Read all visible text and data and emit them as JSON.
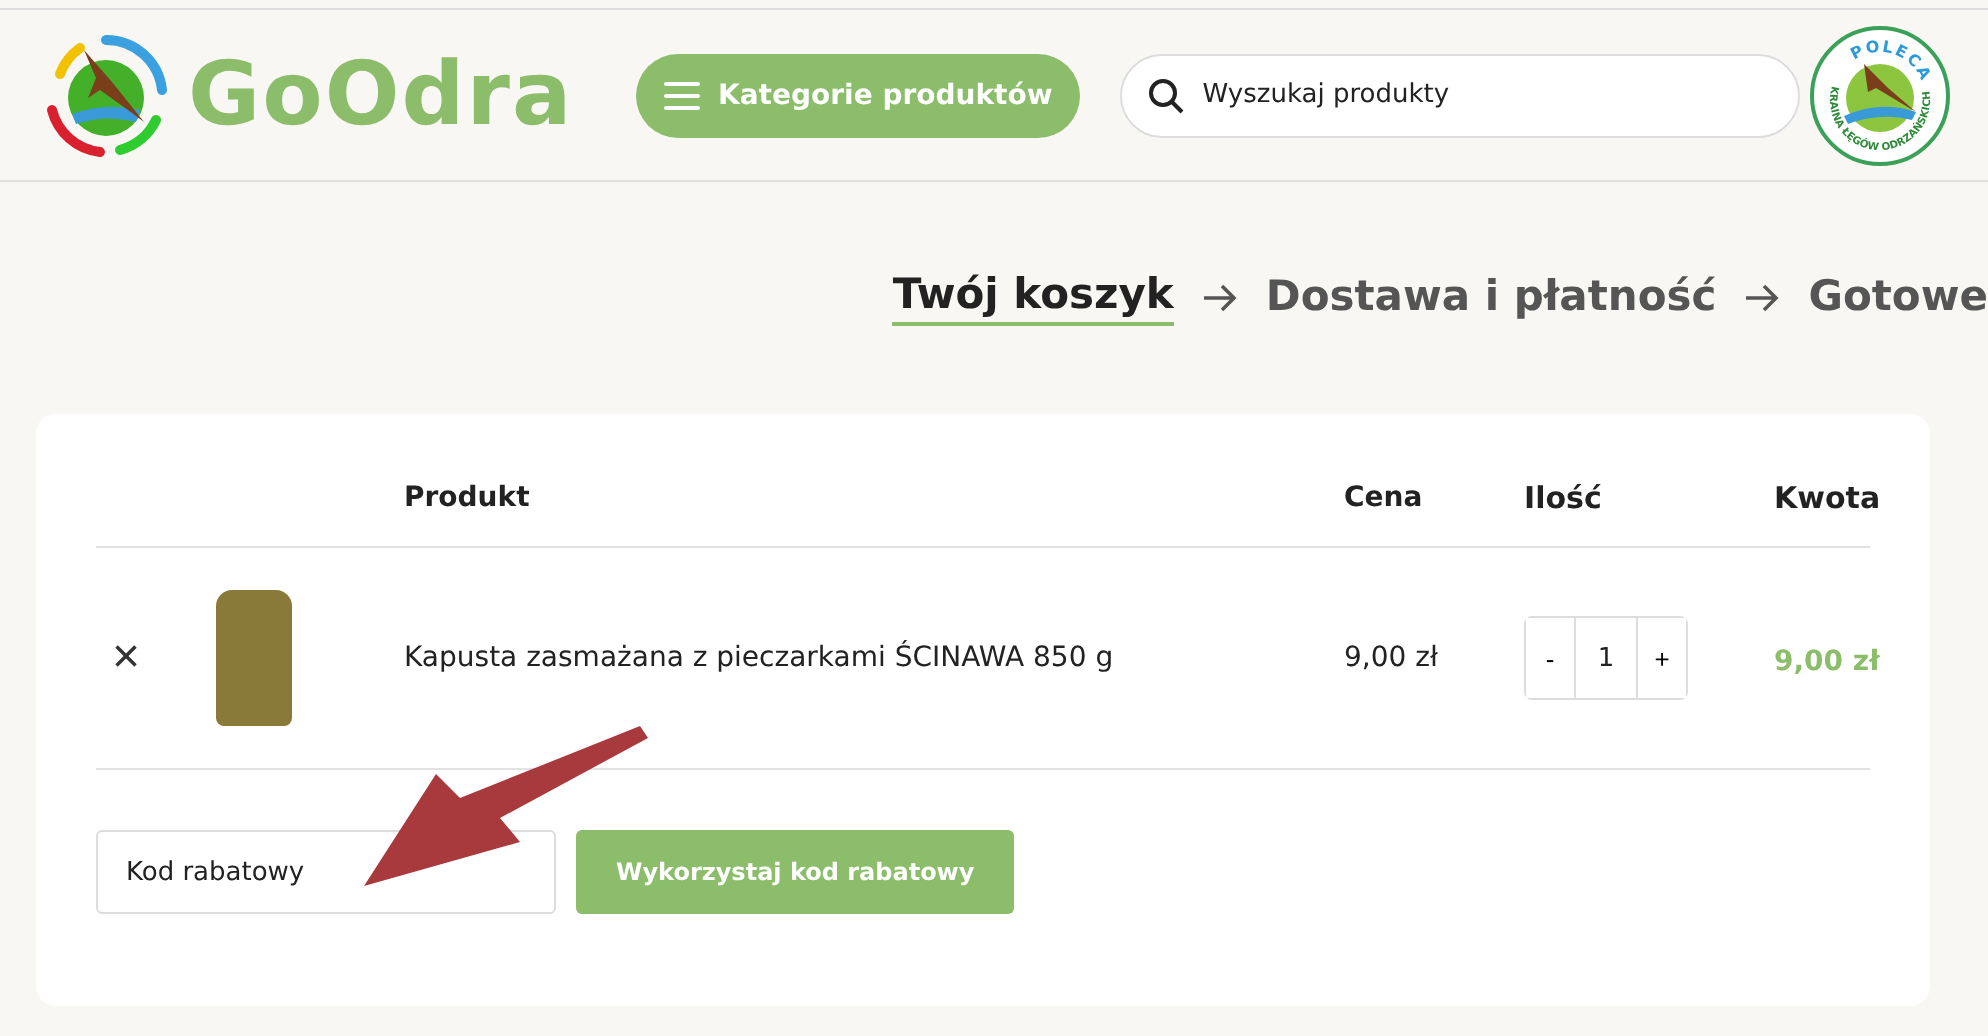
{
  "header": {
    "logo": {
      "text": "GoOdra"
    },
    "categories_button": {
      "label": "Kategorie produktów"
    },
    "search": {
      "placeholder": "Wyszukaj produkty"
    },
    "badge": {
      "top_text": "POLECA",
      "ring_text": "KRAINA ŁĘGÓW ODRZAŃSKICH"
    }
  },
  "steps": [
    {
      "label": "Twój koszyk",
      "selected": true
    },
    {
      "label": "Dostawa i płatność",
      "selected": false
    },
    {
      "label": "Gotowe",
      "selected": false
    }
  ],
  "cart": {
    "columns": [
      "Produkt",
      "Cena",
      "Ilość",
      "Kwota"
    ],
    "rows": [
      {
        "remove": "×",
        "name": "Kapusta zasmażana z pieczarkami ŚCINAWA 850 g",
        "price": "9,00 zł",
        "minus": "-",
        "quantity": "1",
        "plus": "+",
        "total": "9,00 zł"
      }
    ],
    "coupon": {
      "placeholder": "Kod rabatowy",
      "button": "Wykorzystaj kod rabatowy"
    }
  }
}
